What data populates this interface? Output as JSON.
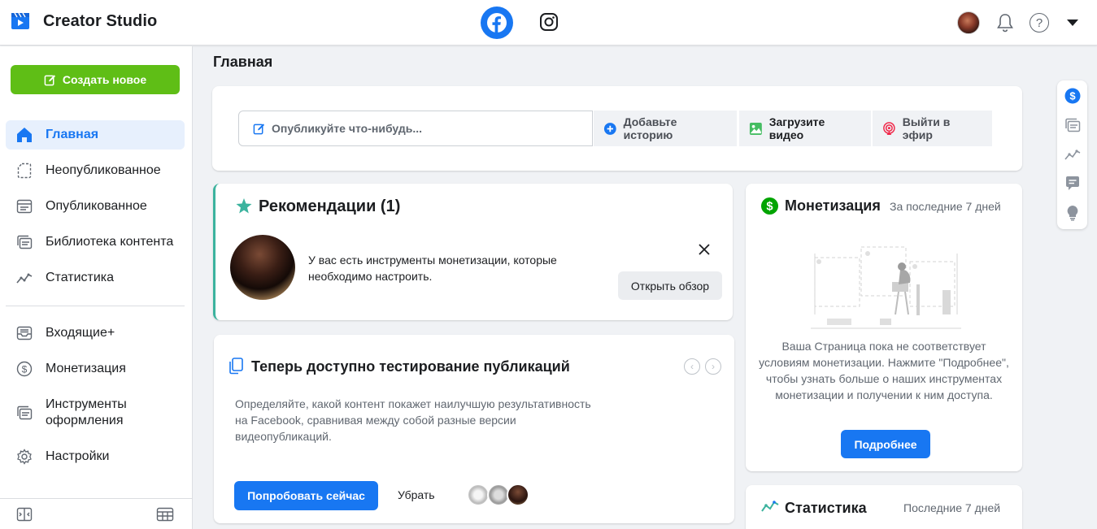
{
  "app": {
    "title": "Creator Studio"
  },
  "header": {
    "platforms": [
      "facebook-icon",
      "instagram-icon"
    ],
    "icons": [
      "avatar",
      "bell-icon",
      "help-icon",
      "caret-down-icon"
    ],
    "help_glyph": "?"
  },
  "sidebar": {
    "create_label": "Создать новое",
    "items": [
      {
        "label": "Главная",
        "icon": "home-icon",
        "active": true
      },
      {
        "label": "Неопубликованное",
        "icon": "draft-icon",
        "active": false
      },
      {
        "label": "Опубликованное",
        "icon": "published-icon",
        "active": false
      },
      {
        "label": "Библиотека контента",
        "icon": "library-icon",
        "active": false
      },
      {
        "label": "Статистика",
        "icon": "stats-icon",
        "active": false
      },
      {
        "label": "Входящие+",
        "icon": "inbox-icon",
        "active": false
      },
      {
        "label": "Монетизация",
        "icon": "dollar-icon",
        "active": false
      },
      {
        "label": "Инструменты оформления",
        "label_line1": "Инструменты",
        "label_line2": "оформления",
        "icon": "tools-icon",
        "active": false
      },
      {
        "label": "Настройки",
        "icon": "gear-icon",
        "active": false
      }
    ]
  },
  "main": {
    "title": "Главная",
    "composer": {
      "placeholder": "Опубликуйте что-нибудь...",
      "actions": [
        "Добавьте историю",
        "Загрузите видео",
        "Выйти в эфир"
      ]
    },
    "recommendations": {
      "title": "Рекомендации (1)",
      "text": "У вас есть инструменты монетизации, которые необходимо настроить.",
      "button": "Открыть обзор"
    },
    "testing": {
      "title": "Теперь доступно тестирование публикаций",
      "description": "Определяйте, какой контент покажет наилучшую результативность на Facebook, сравнивая между собой разные версии видеопубликаций.",
      "try_button": "Попробовать сейчас",
      "remove": "Убрать",
      "prev": "‹",
      "next": "›"
    },
    "monetization": {
      "title": "Монетизация",
      "period": "За последние 7 дней",
      "text": "Ваша Страница пока не соответствует условиям монетизации. Нажмите \"Подробнее\", чтобы узнать больше о наших инструментах монетизации и получении к ним доступа.",
      "button": "Подробнее"
    },
    "statistics": {
      "title": "Статистика",
      "period": "Последние 7 дней"
    }
  },
  "colors": {
    "brand_blue": "#1877f2",
    "create_green": "#5fbe16",
    "accent_teal": "#3cb39e",
    "money_green": "#00a400"
  }
}
